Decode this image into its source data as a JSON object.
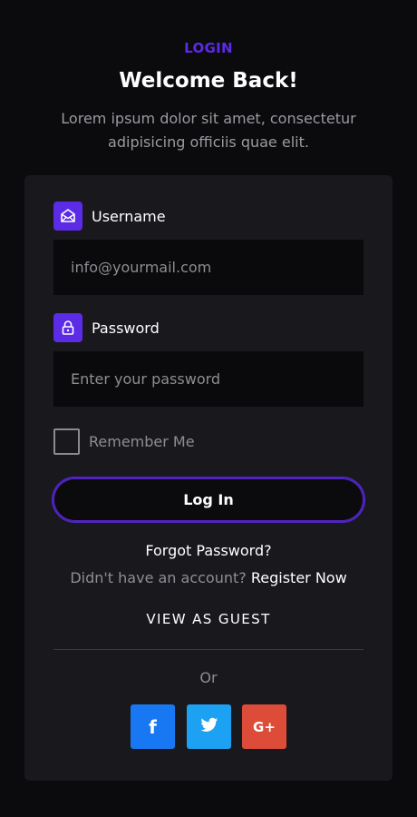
{
  "header": {
    "eyebrow": "LOGIN",
    "title": "Welcome Back!",
    "subtitle": "Lorem ipsum dolor sit amet, consectetur adipisicing officiis quae elit."
  },
  "form": {
    "username_label": "Username",
    "username_icon": "envelope-icon",
    "username_placeholder": "info@yourmail.com",
    "password_label": "Password",
    "password_icon": "lock-icon",
    "password_placeholder": "Enter your password",
    "remember_label": "Remember Me",
    "login_label": "Log In"
  },
  "links": {
    "forgot": "Forgot Password?",
    "register_prompt": "Didn't have an account?",
    "register_link": "Register Now",
    "guest": "VIEW AS GUEST",
    "or": "Or"
  },
  "social": [
    {
      "name": "facebook",
      "icon": "facebook-icon",
      "glyph": "f",
      "color": "#1877f2"
    },
    {
      "name": "twitter",
      "icon": "twitter-icon",
      "glyph": "",
      "color": "#1da1f2"
    },
    {
      "name": "google-plus",
      "icon": "google-plus-icon",
      "glyph": "G+",
      "color": "#dd4b39"
    }
  ],
  "colors": {
    "accent": "#5b2be6",
    "background": "#0b0b0e",
    "card": "#19191d",
    "input": "#0a0a0c"
  }
}
